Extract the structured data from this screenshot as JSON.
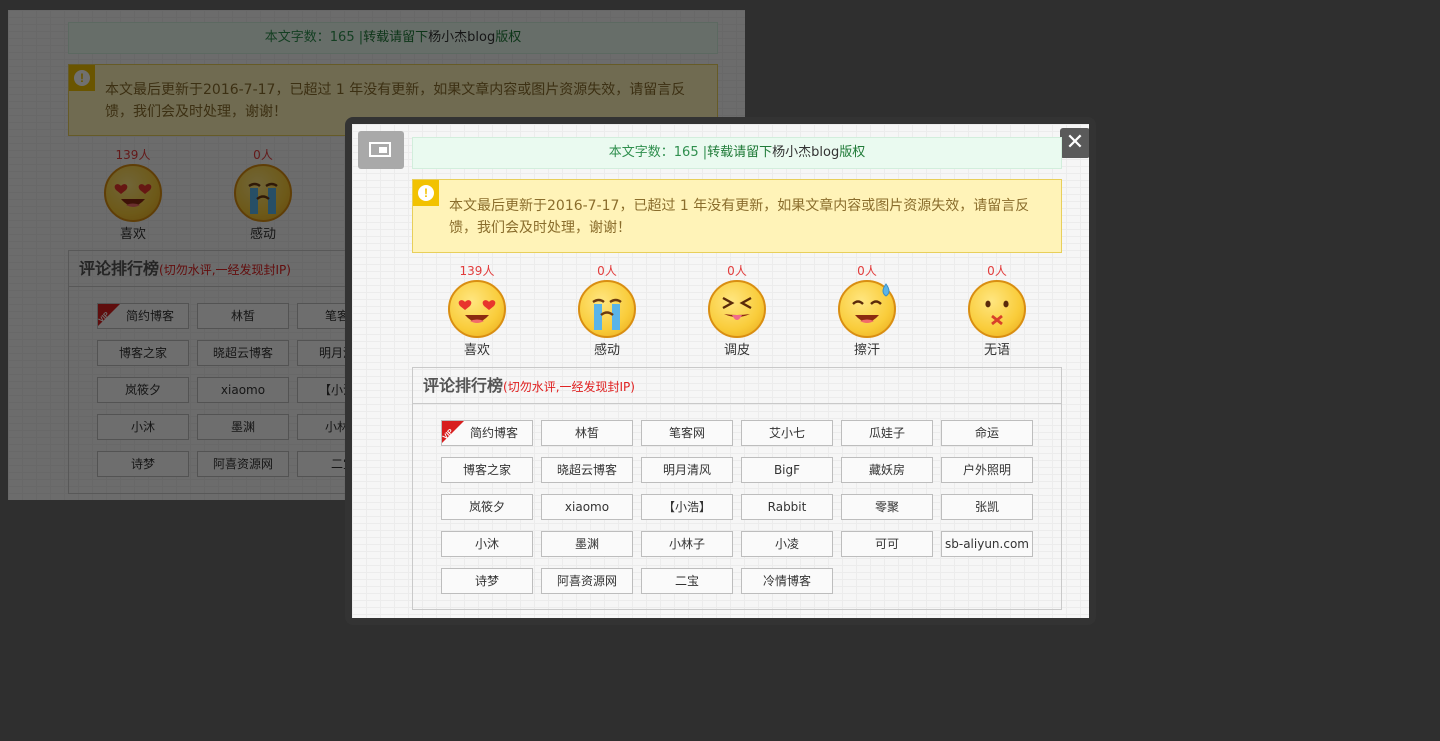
{
  "article": {
    "wordcount": {
      "prefix": "本文字数：165 |",
      "link": "转载请留下",
      "blog": "杨小杰blog",
      "suffix": "版权"
    },
    "notice": {
      "text": "本文最后更新于2016-7-17，已超过 1 年没有更新，如果文章内容或图片资源失效，请留言反馈，我们会及时处理，谢谢！"
    },
    "reactions": [
      {
        "count": "139",
        "unit": "人",
        "label": "喜欢",
        "icon": "heart-eyes-icon"
      },
      {
        "count": "0",
        "unit": "人",
        "label": "感动",
        "icon": "crying-icon"
      },
      {
        "count": "0",
        "unit": "人",
        "label": "调皮",
        "icon": "tongue-out-icon"
      },
      {
        "count": "0",
        "unit": "人",
        "label": "擦汗",
        "icon": "sweat-smile-icon"
      },
      {
        "count": "0",
        "unit": "人",
        "label": "无语",
        "icon": "speechless-icon"
      }
    ],
    "ranking": {
      "title": "评论排行榜",
      "subtitle": "(切勿水评,一经发现封IP)",
      "vip_badge": "VIP",
      "friends": [
        "简约博客",
        "林皙",
        "笔客网",
        "艾小七",
        "瓜娃子",
        "命运",
        "博客之家",
        "晓超云博客",
        "明月清风",
        "BigF",
        "藏妖房",
        "户外照明",
        "岚筱夕",
        "xiaomo",
        "【小浩】",
        "Rabbit",
        "零聚",
        "张凯",
        "小沐",
        "墨渊",
        "小林子",
        "小凌",
        "可可",
        "sb-aliyun.com",
        "诗梦",
        "阿喜资源网",
        "二宝",
        "冷情博客"
      ]
    }
  },
  "modal": {
    "close_label": "✕",
    "fullscreen_icon": "fullscreen-toggle-icon"
  },
  "colors": {
    "overlay": "#6b6b6b",
    "modal_frame": "#333333",
    "accent_red": "#e02020",
    "notice_bg": "#fff3b8",
    "wordcount_bg": "#eafaf0"
  }
}
